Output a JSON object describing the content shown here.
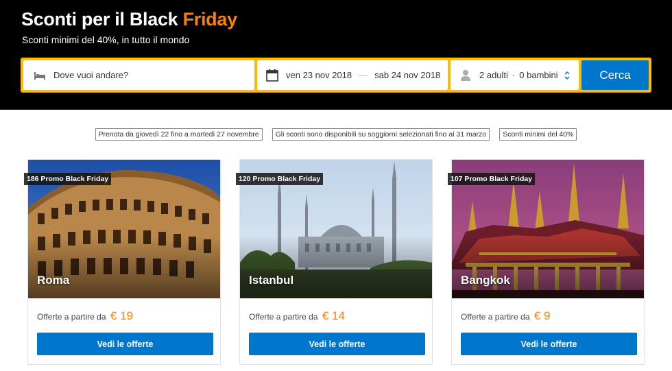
{
  "hero": {
    "title_main": "Sconti per il Black ",
    "title_accent": "Friday",
    "subtitle": "Sconti minimi del 40%, in tutto il mondo"
  },
  "search": {
    "destination_placeholder": "Dove vuoi andare?",
    "checkin": "ven 23 nov 2018",
    "separator": "—",
    "checkout": "sab 24 nov 2018",
    "adults": "2 adulti",
    "dot": "·",
    "children": "0 bambini",
    "button_label": "Cerca"
  },
  "info_chips": [
    "Prenota da giovedì 22 fino a martedì 27 novembre",
    "Gli sconti sono disponibili su soggiorni selezionati fino al 31 marzo",
    "Sconti minimi del 40%"
  ],
  "cards": [
    {
      "badge": "186 Promo Black Friday",
      "city": "Roma",
      "offer_text": "Offerte a partire da",
      "price": "€ 19",
      "button_label": "Vedi le offerte"
    },
    {
      "badge": "120 Promo Black Friday",
      "city": "Istanbul",
      "offer_text": "Offerte a partire da",
      "price": "€ 14",
      "button_label": "Vedi le offerte"
    },
    {
      "badge": "107 Promo Black Friday",
      "city": "Bangkok",
      "offer_text": "Offerte a partire da",
      "price": "€ 9",
      "button_label": "Vedi le offerte"
    }
  ],
  "colors": {
    "accent_orange": "#ff8000",
    "search_border": "#febb02",
    "primary_blue": "#0077cc"
  },
  "icons": {
    "destination": "bed-icon",
    "dates": "calendar-icon",
    "guests": "person-icon",
    "guests_toggle": "chevron-updown-icon"
  }
}
